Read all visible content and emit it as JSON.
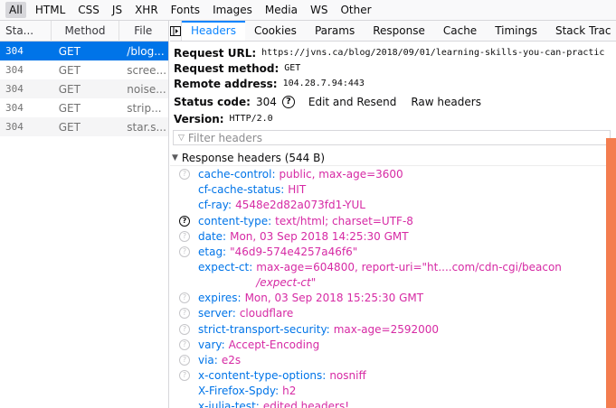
{
  "filters": [
    "All",
    "HTML",
    "CSS",
    "JS",
    "XHR",
    "Fonts",
    "Images",
    "Media",
    "WS",
    "Other"
  ],
  "requests": {
    "columns": {
      "status": "Sta...",
      "method": "Method",
      "file": "File"
    },
    "rows": [
      {
        "status": "304",
        "method": "GET",
        "file": "/blog..."
      },
      {
        "status": "304",
        "method": "GET",
        "file": "scree..."
      },
      {
        "status": "304",
        "method": "GET",
        "file": "noise..."
      },
      {
        "status": "304",
        "method": "GET",
        "file": "strip..."
      },
      {
        "status": "304",
        "method": "GET",
        "file": "star.s..."
      }
    ]
  },
  "tabs": [
    "Headers",
    "Cookies",
    "Params",
    "Response",
    "Cache",
    "Timings",
    "Stack Trac"
  ],
  "summary": {
    "url_label": "Request URL:",
    "url_value": "https://jvns.ca/blog/2018/09/01/learning-skills-you-can-practic",
    "method_label": "Request method:",
    "method_value": "GET",
    "remote_label": "Remote address:",
    "remote_value": "104.28.7.94:443",
    "status_label": "Status code:",
    "status_value": "304",
    "edit_resend": "Edit and Resend",
    "raw_headers": "Raw headers",
    "version_label": "Version:",
    "version_value": "HTTP/2.0"
  },
  "filter_placeholder": "Filter headers",
  "response_section": "Response headers (544 B)",
  "headers": [
    {
      "name": "cache-control:",
      "value": "public, max-age=3600"
    },
    {
      "name": "cf-cache-status:",
      "value": "HIT"
    },
    {
      "name": "cf-ray:",
      "value": "4548e2d82a073fd1-YUL"
    },
    {
      "name": "content-type:",
      "value": "text/html; charset=UTF-8"
    },
    {
      "name": "date:",
      "value": "Mon, 03 Sep 2018 14:25:30 GMT"
    },
    {
      "name": "etag:",
      "value": "\"46d9-574e4257a46f6\""
    },
    {
      "name": "expect-ct:",
      "value": "max-age=604800, report-uri=\"ht....com/cdn-cgi/beacon",
      "value2": "/expect-ct\""
    },
    {
      "name": "expires:",
      "value": "Mon, 03 Sep 2018 15:25:30 GMT"
    },
    {
      "name": "server:",
      "value": "cloudflare"
    },
    {
      "name": "strict-transport-security:",
      "value": "max-age=2592000"
    },
    {
      "name": "vary:",
      "value": "Accept-Encoding"
    },
    {
      "name": "via:",
      "value": "e2s"
    },
    {
      "name": "x-content-type-options:",
      "value": "nosniff"
    },
    {
      "name": "X-Firefox-Spdy:",
      "value": "h2"
    },
    {
      "name": "x-julia-test:",
      "value": "edited headers!"
    }
  ],
  "colors": {
    "accent": "#0a84ff",
    "selected_row": "#0074e8",
    "header_name": "#0074e8",
    "header_value": "#d62aa4",
    "scrollbar": "#f47d4f"
  },
  "icons": {
    "help": "question-circle-icon",
    "panel_toggle": "panel-toggle-icon",
    "filter": "funnel-icon",
    "section_arrow": "triangle-down-icon"
  }
}
